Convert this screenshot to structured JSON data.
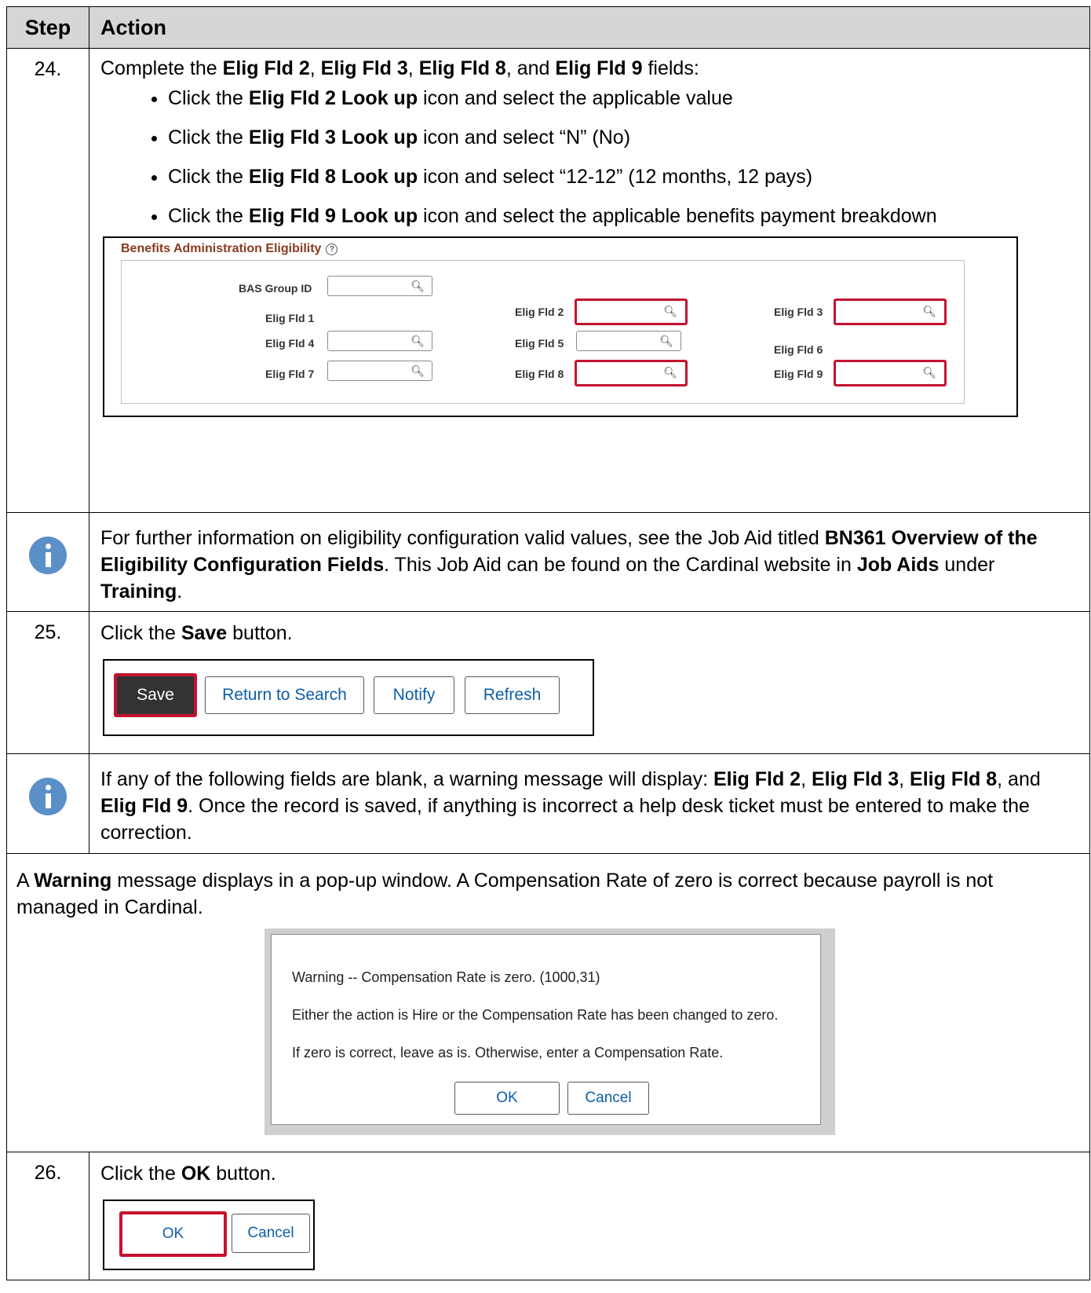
{
  "table": {
    "col_step": "Step",
    "col_action": "Action"
  },
  "step24": {
    "num": "24.",
    "intro": [
      "Complete the ",
      "Elig Fld 2",
      ", ",
      "Elig Fld 3",
      ", ",
      "Elig Fld 8",
      ", and ",
      "Elig Fld 9",
      " fields:"
    ],
    "bullets": [
      [
        "Click the ",
        "Elig Fld 2 Look up",
        " icon and select the applicable value"
      ],
      [
        "Click the ",
        "Elig Fld 3 Look up",
        " icon and select “N” (No)"
      ],
      [
        "Click the ",
        "Elig Fld 8 Look up",
        " icon and select “12-12” (12 months, 12 pays)"
      ],
      [
        "Click the ",
        "Elig Fld 9 Look up",
        " icon and select the applicable benefits payment breakdown"
      ]
    ],
    "panel": {
      "title": "Benefits Administration Eligibility",
      "help": "?",
      "bas_group": "BAS Group ID",
      "f1": "Elig Fld 1",
      "f2": "Elig Fld 2",
      "f3": "Elig Fld 3",
      "f4": "Elig Fld 4",
      "f5": "Elig Fld 5",
      "f6": "Elig Fld 6",
      "f7": "Elig Fld 7",
      "f8": "Elig Fld 8",
      "f9": "Elig Fld 9"
    }
  },
  "note1": [
    "For further information on eligibility configuration valid values, see the Job Aid titled ",
    "BN361 Overview of the Eligibility Configuration Fields",
    ". This Job Aid can be found on the Cardinal website in ",
    "Job Aids",
    " under ",
    "Training",
    "."
  ],
  "step25": {
    "num": "25.",
    "text": [
      "Click the ",
      "Save",
      " button."
    ],
    "buttons": {
      "save": "Save",
      "return": "Return to Search",
      "notify": "Notify",
      "refresh": "Refresh"
    }
  },
  "note2": [
    "If any of the following fields are blank, a warning message will display: ",
    "Elig Fld 2",
    ", ",
    "Elig Fld 3",
    ", ",
    "Elig Fld 8",
    ", and ",
    "Elig Fld 9",
    ". Once the record is saved, if anything is incorrect a help desk ticket must be entered to make the correction."
  ],
  "warning": {
    "text": [
      "A ",
      "Warning",
      " message displays in a pop-up window. A Compensation Rate of zero is correct because payroll is not managed in Cardinal."
    ],
    "dialog": {
      "line1": "Warning -- Compensation Rate is zero. (1000,31)",
      "line2": "Either the action is Hire or the Compensation Rate has been changed to zero.",
      "line3": "If zero is correct, leave as is.  Otherwise, enter a Compensation Rate.",
      "ok": "OK",
      "cancel": "Cancel"
    }
  },
  "step26": {
    "num": "26.",
    "text": [
      "Click the ",
      "OK",
      " button."
    ],
    "ok": "OK",
    "cancel": "Cancel"
  },
  "icons": {
    "search": "magnifier-icon",
    "info": "info-icon",
    "help": "help-icon"
  },
  "colors": {
    "highlight": "#c4122f",
    "header_bg": "#d6d6d6",
    "info": "#5b8fc7",
    "panel_title": "#8a3a1e",
    "link": "#0e5ea8"
  }
}
